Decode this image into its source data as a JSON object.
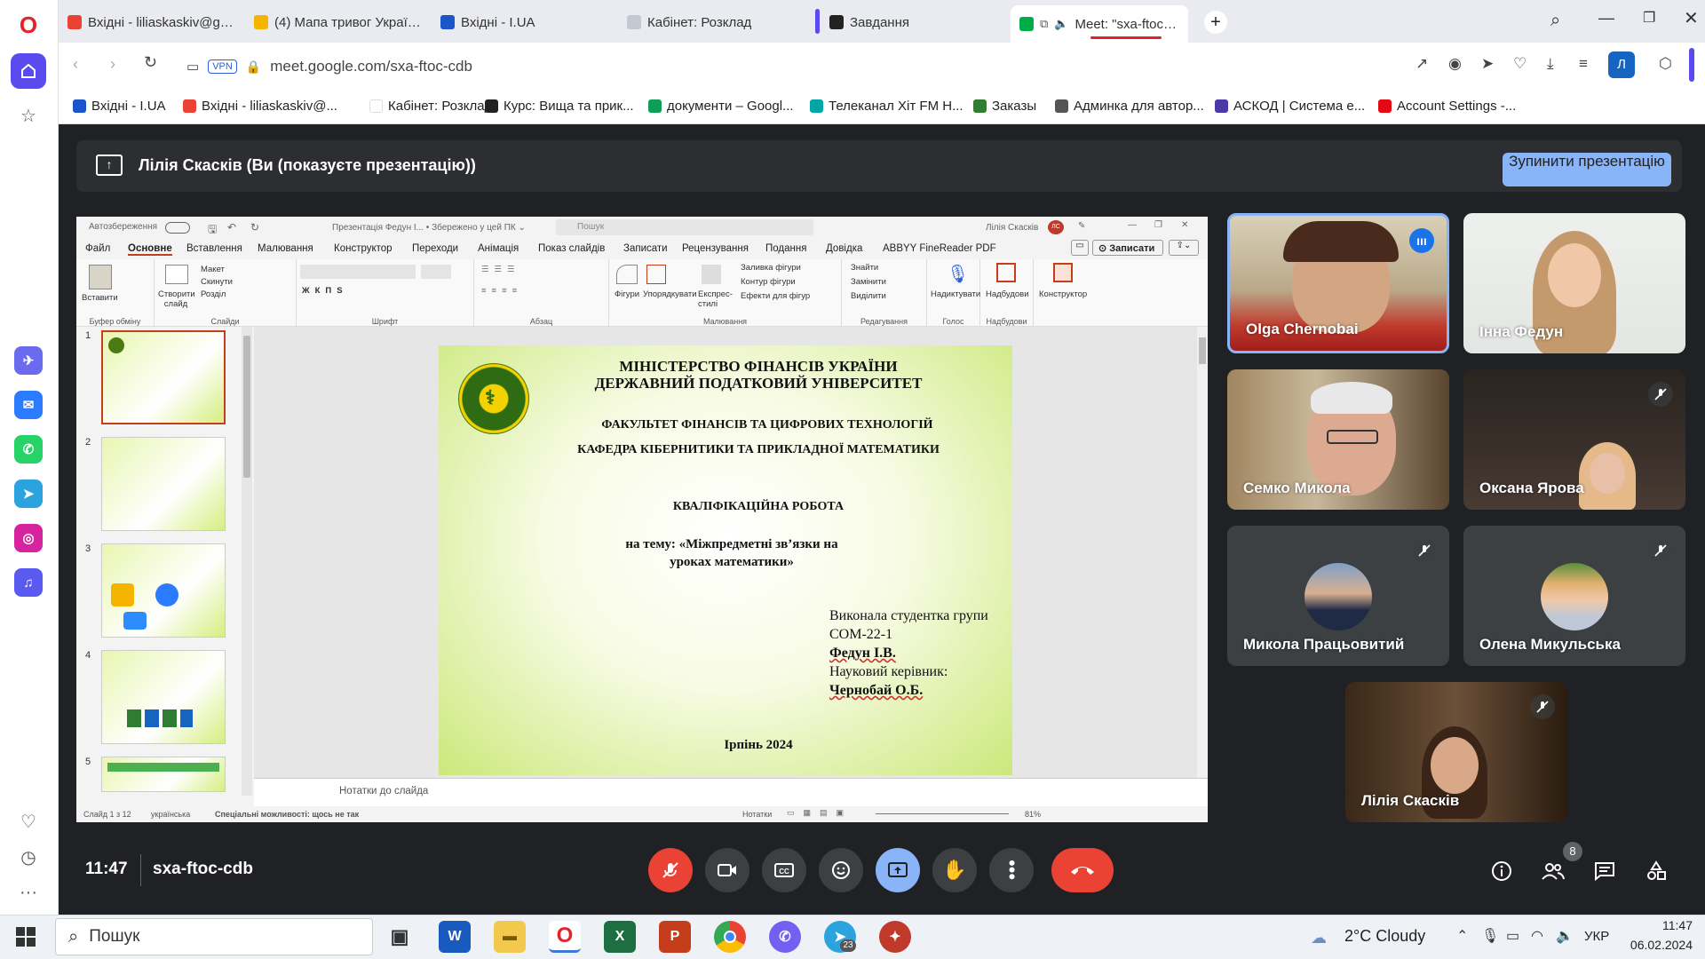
{
  "browser": {
    "tabs": [
      {
        "label": "Вхідні - liliaskaskiv@gmai",
        "color": "#ea4335"
      },
      {
        "label": "(4) Мапа тривог України",
        "color": "#f4b400"
      },
      {
        "label": "Вхідні - I.UA",
        "color": "#1a56c9"
      },
      {
        "label": "Кабінет: Розклад",
        "color": "#c4c8d0"
      },
      {
        "label": "Завдання",
        "color": "#222222"
      },
      {
        "label": "Meet: \"sxa-ftoc-cd",
        "color": "#00ac47"
      }
    ],
    "vpn_badge": "VPN",
    "url": "meet.google.com/sxa-ftoc-cdb",
    "profile_letter": "Л",
    "bookmarks": [
      {
        "label": "Вхідні - I.UA",
        "color": "#1a56c9"
      },
      {
        "label": "Вхідні - liliaskaskiv@...",
        "color": "#ea4335"
      },
      {
        "label": "Кабінет: Розклад",
        "color": "#ffffff"
      },
      {
        "label": "Курс: Вища та прик...",
        "color": "#222222"
      },
      {
        "label": "документи – Googl...",
        "color": "#0f9d58"
      },
      {
        "label": "Телеканал Хіт FM Н...",
        "color": "#00a6a6"
      },
      {
        "label": "Заказы",
        "color": "#2e7d32"
      },
      {
        "label": "Админка для автор...",
        "color": "#555555"
      },
      {
        "label": "АСКОД | Система е...",
        "color": "#4a3aa8"
      },
      {
        "label": "Account Settings -...",
        "color": "#e50914"
      }
    ]
  },
  "meet": {
    "presenting_label": "Лілія Скасків (Ви (показуєте презентацію))",
    "stop_button": "Зупинити презентацію",
    "time": "11:47",
    "meeting_code": "sxa-ftoc-cdb",
    "participants_count": "8",
    "tiles": [
      {
        "name": "Olga Chernobai",
        "muted": false,
        "speaking": true
      },
      {
        "name": "Інна Федун",
        "muted": false
      },
      {
        "name": "Семко Микола",
        "muted": false
      },
      {
        "name": "Оксана Ярова",
        "muted": true
      },
      {
        "name": "Микола Працьовитий",
        "muted": true
      },
      {
        "name": "Олена Микульська",
        "muted": true
      },
      {
        "name": "Лілія Скасків",
        "muted": true
      }
    ]
  },
  "ppt": {
    "titlebar": {
      "autosave": "Автозбереження",
      "file": "Презентація Федун І... • Збережено у цей ПК ⌄",
      "search": "Пошук",
      "user": "Лілія Скасків",
      "initials": "ЛС"
    },
    "menu": [
      "Файл",
      "Основне",
      "Вставлення",
      "Малювання",
      "Конструктор",
      "Переходи",
      "Анімація",
      "Показ слайдів",
      "Записати",
      "Рецензування",
      "Подання",
      "Довідка",
      "ABBYY FineReader PDF"
    ],
    "record_button": "Записати",
    "ribbon_groups": [
      "Буфер обміну",
      "Слайди",
      "Шрифт",
      "Абзац",
      "Малювання",
      "Редагування",
      "Голос",
      "Надбудови"
    ],
    "ribbon_buttons": [
      "Вставити",
      "Створити слайд",
      "Макет",
      "Скинути",
      "Розділ",
      "Фігури",
      "Упорядкувати",
      "Експрес-стилі",
      "Заливка фігури",
      "Контур фігури",
      "Ефекти для фігур",
      "Знайти",
      "Замінити",
      "Виділити",
      "Надиктувати",
      "Надбудови",
      "Конструктор"
    ],
    "thumb_numbers": [
      "1",
      "2",
      "3",
      "4",
      "5"
    ],
    "notes_placeholder": "Нотатки до слайда",
    "status": {
      "slide": "Слайд 1 з 12",
      "lang": "українська",
      "accessibility": "Спеціальні можливості: щось не так",
      "notes": "Нотатки",
      "zoom": "81%"
    },
    "slide": {
      "line1": "МІНІСТЕРСТВО ФІНАНСІВ УКРАЇНИ",
      "line2": "ДЕРЖАВНИЙ ПОДАТКОВИЙ УНІВЕРСИТЕТ",
      "faculty": "ФАКУЛЬТЕТ ФІНАНСІВ ТА ЦИФРОВИХ ТЕХНОЛОГІЙ",
      "department": "КАФЕДРА КІБЕРНИТИКИ ТА ПРИКЛАДНОЇ МАТЕМАТИКИ",
      "work_type": "КВАЛІФІКАЦІЙНА РОБОТА",
      "topic_line1": "на тему: «Міжпредметні зв’язки на",
      "topic_line2": "уроках математики»",
      "author1": "Виконала студентка групи",
      "author2": "СОМ-22-1",
      "author3": "Федун І.В.",
      "author4": "Науковий керівник:",
      "author5": "Чернобай О.Б.",
      "footer": "Ірпінь 2024"
    }
  },
  "taskbar": {
    "search": "Пошук",
    "weather": "2°C  Cloudy",
    "lang": "УКР",
    "time": "11:47",
    "date": "06.02.2024",
    "telegram_badge": "23"
  },
  "sidebar_apps": [
    {
      "icon": "testflight-icon",
      "color": "#6b6bf0"
    },
    {
      "icon": "messenger-icon",
      "color": "#2b7bff"
    },
    {
      "icon": "whatsapp-icon",
      "color": "#25d366"
    },
    {
      "icon": "telegram-icon",
      "color": "#2aa3de"
    },
    {
      "icon": "instagram-icon",
      "color": "#d6249f"
    },
    {
      "icon": "music-icon",
      "color": "#5a5af0"
    }
  ]
}
